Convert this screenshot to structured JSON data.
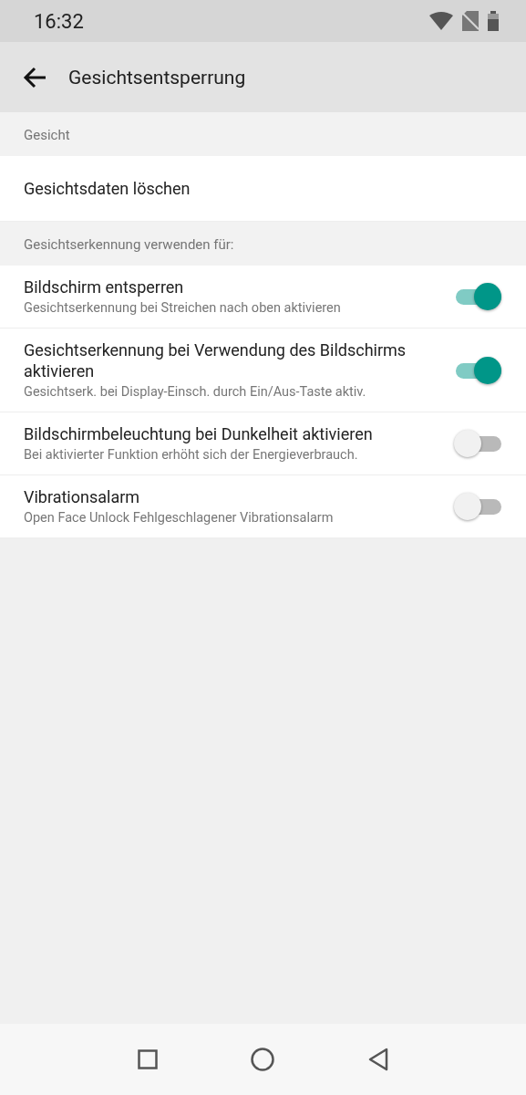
{
  "status_bar": {
    "time": "16:32"
  },
  "app_bar": {
    "title": "Gesichtsentsperrung"
  },
  "sections": [
    {
      "header": "Gesicht",
      "items": [
        {
          "kind": "action",
          "title": "Gesichtsdaten löschen"
        }
      ]
    },
    {
      "header": "Gesichtserkennung verwenden für:",
      "items": [
        {
          "kind": "switch",
          "title": "Bildschirm entsperren",
          "summary": "Gesichtserkennung bei Streichen nach oben aktivieren",
          "on": true
        },
        {
          "kind": "switch",
          "title": "Gesichtserkennung bei Verwendung des Bildschirms aktivieren",
          "summary": "Gesichtserk. bei Display-Einsch. durch Ein/Aus-Taste aktiv.",
          "on": true
        },
        {
          "kind": "switch",
          "title": "Bildschirmbeleuchtung bei Dunkelheit aktivieren",
          "summary": "Bei aktivierter Funktion erhöht sich der Energieverbrauch.",
          "on": false
        },
        {
          "kind": "switch",
          "title": "Vibrationsalarm",
          "summary": "Open Face Unlock Fehlgeschlagener Vibrationsalarm",
          "on": false
        }
      ]
    }
  ]
}
